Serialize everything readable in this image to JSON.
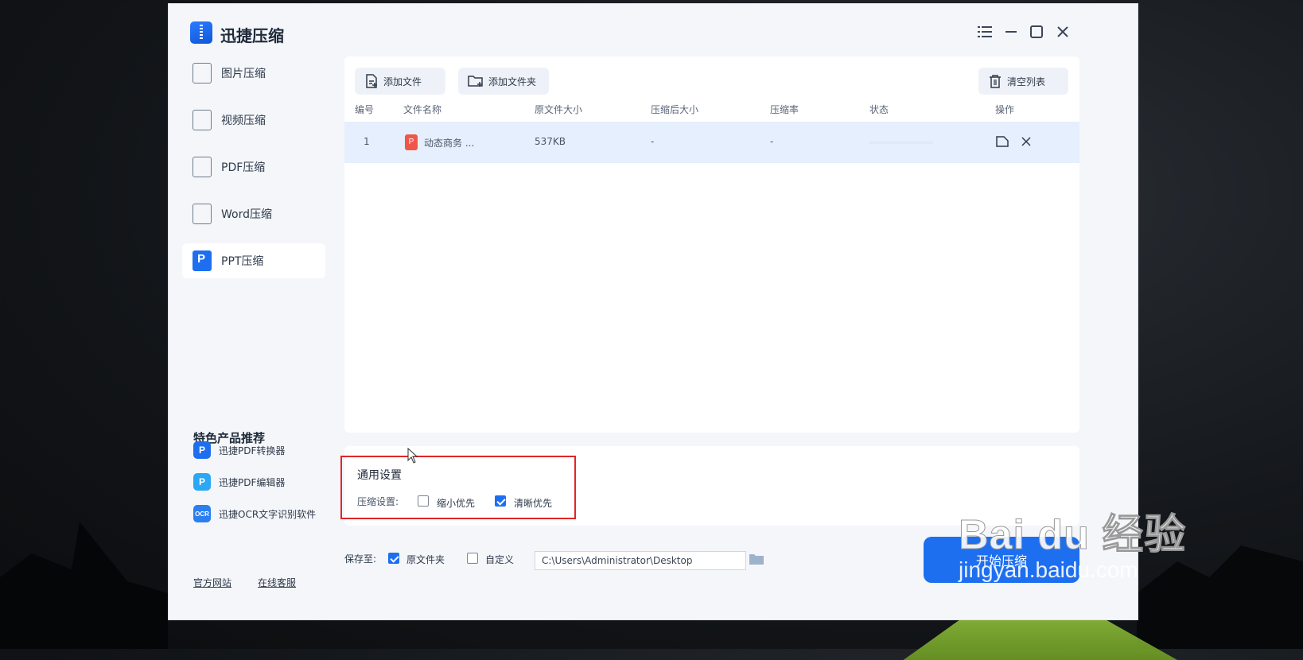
{
  "window": {
    "app_title": "迅捷压缩"
  },
  "sidebar": {
    "items": [
      {
        "label": "图片压缩",
        "icon": "image-icon"
      },
      {
        "label": "视频压缩",
        "icon": "video-icon"
      },
      {
        "label": "PDF压缩",
        "icon": "pdf-icon"
      },
      {
        "label": "Word压缩",
        "icon": "word-icon"
      },
      {
        "label": "PPT压缩",
        "icon": "ppt-icon",
        "active": true
      }
    ],
    "recommend_title": "特色产品推荐",
    "recommend": [
      {
        "label": "迅捷PDF转换器",
        "color": "#1e6ff0"
      },
      {
        "label": "迅捷PDF编辑器",
        "color": "#2aa7f5"
      },
      {
        "label": "迅捷OCR文字识别软件",
        "color": "#2a7ff0"
      }
    ],
    "links": {
      "official": "官方网站",
      "service": "在线客服"
    }
  },
  "toolbar": {
    "add_file": "添加文件",
    "add_folder": "添加文件夹",
    "clear_list": "清空列表"
  },
  "table": {
    "headers": [
      "编号",
      "文件名称",
      "原文件大小",
      "压缩后大小",
      "压缩率",
      "状态",
      "操作"
    ],
    "rows": [
      {
        "index": "1",
        "name": "动态商务 ...",
        "original_size": "537KB",
        "compressed_size": "-",
        "ratio": "-"
      }
    ]
  },
  "settings": {
    "title": "通用设置",
    "label": "压缩设置:",
    "options": [
      {
        "label": "缩小优先",
        "checked": false
      },
      {
        "label": "清晰优先",
        "checked": true
      }
    ]
  },
  "save": {
    "label": "保存至:",
    "original_folder": "原文件夹",
    "original_checked": true,
    "custom": "自定义",
    "custom_checked": false,
    "path": "C:\\Users\\Administrator\\Desktop"
  },
  "start_button": "开始压缩",
  "watermark": {
    "main": "Bai du 经验",
    "sub": "jingyan.baidu.com"
  },
  "accent_color": "#1e6ff0"
}
